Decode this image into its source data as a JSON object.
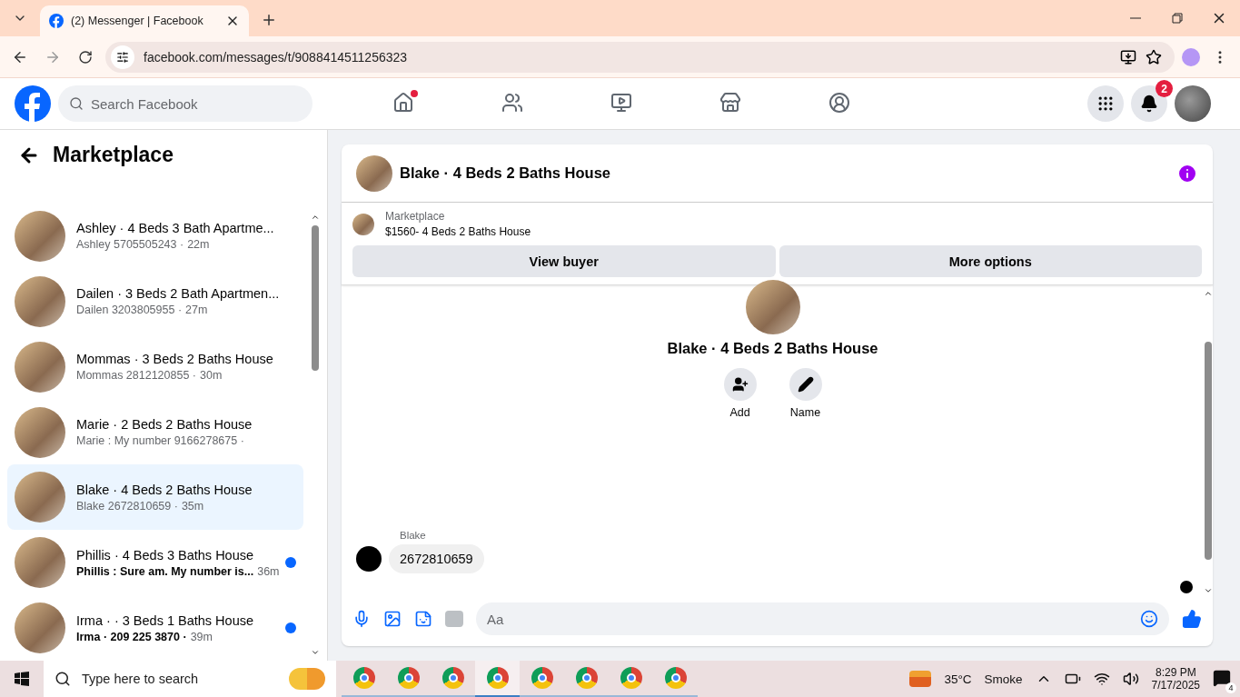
{
  "browser": {
    "tabs": [
      {
        "title": "(2) Messenger | Facebook",
        "selected": true
      }
    ],
    "address": "facebook.com/messages/t/9088414511256323"
  },
  "topbar": {
    "search": {
      "placeholder": "Search Facebook"
    },
    "nav": [
      {
        "kind": "home",
        "selected": false,
        "dot": true
      },
      {
        "kind": "friends",
        "selected": false,
        "dot": false
      },
      {
        "kind": "video",
        "selected": false,
        "dot": false
      },
      {
        "kind": "marketplace",
        "selected": false,
        "dot": false
      },
      {
        "kind": "groups",
        "selected": false,
        "dot": false
      }
    ],
    "notifications_badge": "2"
  },
  "sidebar": {
    "title": "Marketplace",
    "conversations": [
      {
        "title": "Ashley · 4 Beds 3 Bath Apartme...",
        "preview": "Ashley 5705505243 ·",
        "time": "22m",
        "unread": false,
        "selected": false
      },
      {
        "title": "Dailen · 3 Beds 2 Bath Apartmen...",
        "preview": "Dailen 3203805955 ·",
        "time": "27m",
        "unread": false,
        "selected": false
      },
      {
        "title": "Mommas · 3 Beds 2 Baths House",
        "preview": "Mommas 2812120855 ·",
        "time": "30m",
        "unread": false,
        "selected": false
      },
      {
        "title": "Marie · 2 Beds 2 Baths House",
        "preview": "Marie : My number 9166278675 ·",
        "unread": false,
        "selected": false
      },
      {
        "title": "Blake · 4 Beds 2 Baths House",
        "preview": "Blake 2672810659 ·",
        "time": "35m",
        "unread": false,
        "selected": true
      },
      {
        "title": "Phillis · 4 Beds 3 Baths House",
        "preview": "Phillis : Sure am. My number is...",
        "time": "36m",
        "unread": true,
        "selected": false
      },
      {
        "title": "Irma · · 3 Beds 1 Baths House",
        "preview": "Irma · 209 225 3870 ·",
        "time": "39m",
        "unread": true,
        "selected": false
      }
    ]
  },
  "chat": {
    "title": "Blake · 4 Beds 2 Baths House",
    "listing": {
      "label": "Marketplace",
      "title": "$1560- 4 Beds 2 Baths House"
    },
    "buttons": [
      "View buyer",
      "More options"
    ],
    "profile": {
      "name": "Blake · 4 Beds 2 Baths House",
      "actions": [
        {
          "kind": "add",
          "label": "Add"
        },
        {
          "kind": "name",
          "label": "Name"
        }
      ]
    },
    "messages": [
      {
        "sender": "Blake",
        "text": "2672810659"
      }
    ],
    "composer": {
      "placeholder": "Aa"
    }
  },
  "taskbar": {
    "search": {
      "placeholder": "Type here to search"
    },
    "apps": [
      {
        "kind": "chrome",
        "selected": false
      },
      {
        "kind": "chrome",
        "selected": false
      },
      {
        "kind": "chrome",
        "selected": false
      },
      {
        "kind": "chrome",
        "selected": true
      },
      {
        "kind": "chrome",
        "selected": false
      },
      {
        "kind": "chrome",
        "selected": false
      },
      {
        "kind": "chrome",
        "selected": false
      },
      {
        "kind": "chrome",
        "selected": false
      }
    ],
    "weather": {
      "temp": "35°C",
      "condition": "Smoke"
    },
    "time": "8:29 PM",
    "date": "7/17/2025",
    "notifications": "4"
  }
}
